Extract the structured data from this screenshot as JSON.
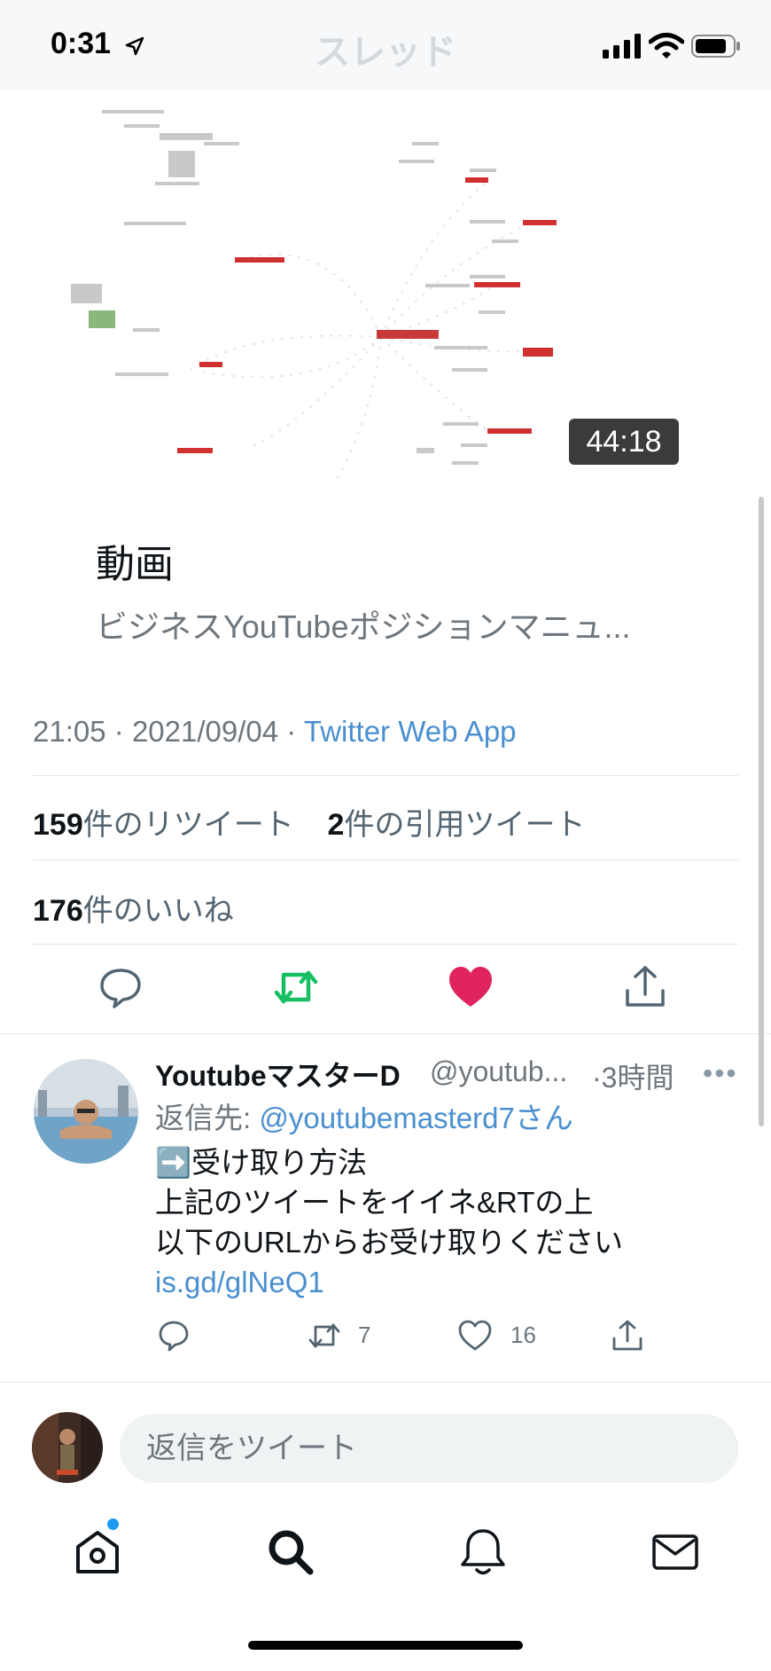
{
  "status_bar": {
    "time": "0:31",
    "faded_title": "スレッド"
  },
  "video": {
    "duration": "44:18"
  },
  "card": {
    "title": "動画",
    "subtitle": "ビジネスYouTubeポジションマニュ..."
  },
  "tweet_meta": {
    "time": "21:05",
    "date": "2021/09/04",
    "separator": "·",
    "app": "Twitter Web App"
  },
  "stats": {
    "retweets_count": "159",
    "retweets_label": "件のリツイート",
    "quotes_count": "2",
    "quotes_label": "件の引用ツイート",
    "likes_count": "176",
    "likes_label": "件のいいね"
  },
  "colors": {
    "retweet_active": "#17bf63",
    "like_active": "#e0245e",
    "link": "#4a8fd0"
  },
  "reply": {
    "name": "YoutubeマスターD",
    "handle": "@youtub...",
    "time": "·3時間",
    "reply_to_label": "返信先:",
    "reply_to_mention": "@youtubemasterd7さん",
    "body_lines": [
      "➡️受け取り方法",
      "上記のツイートをイイネ&RTの上",
      "以下のURLからお受け取りください"
    ],
    "link": "is.gd/glNeQ1",
    "retweet_count": "7",
    "like_count": "16"
  },
  "composer": {
    "placeholder": "返信をツイート"
  },
  "tabbar": {
    "items": [
      "home-icon",
      "search-icon",
      "notifications-icon",
      "messages-icon"
    ]
  }
}
